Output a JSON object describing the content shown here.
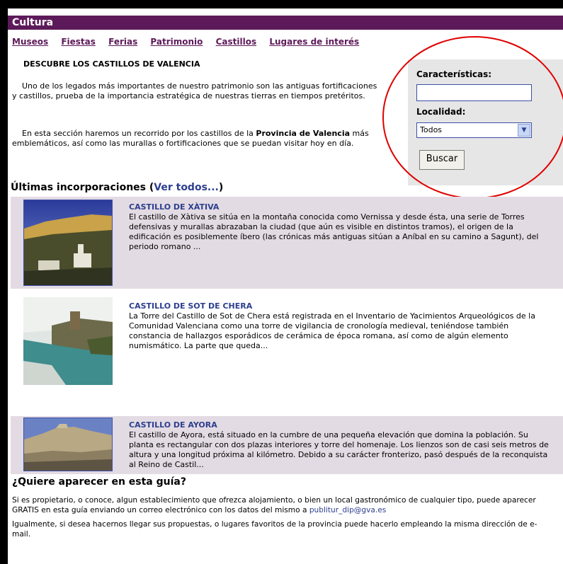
{
  "header": {
    "title": "Cultura"
  },
  "nav": [
    "Museos",
    "Fiestas",
    "Ferias",
    "Patrimonio",
    "Castillos",
    "Lugares de interés"
  ],
  "intro": {
    "title": "DESCUBRE LOS CASTILLOS DE VALENCIA",
    "p1": "Uno de los legados más importantes de nuestro patrimonio son las antiguas fortificaciones y castillos, prueba de la importancia estratégica de nuestras tierras en tiempos pretéritos.",
    "p2_pre": "En esta sección haremos un recorrido por los castillos de la ",
    "p2_bold": "Provincia de Valencia",
    "p2_post": " más emblemáticos, así como las murallas o fortificaciones que se puedan visitar hoy en día."
  },
  "search": {
    "caracteristicas_label": "Características:",
    "caracteristicas_value": "",
    "localidad_label": "Localidad:",
    "localidad_value": "Todos",
    "button": "Buscar"
  },
  "latest": {
    "title": "Últimas incorporaciones",
    "link": "Ver todos...",
    "items": [
      {
        "title": "CASTILLO DE XÀTIVA",
        "text": "El castillo de Xàtiva se sitúa en la montaña conocida como Vernissa y desde ésta, una serie de Torres defensivas y murallas abrazaban la ciudad (que aún es visible en distintos tramos), el origen de la edificación es posiblemente íbero (las crónicas más antiguas sitúan a Aníbal en su camino a Sagunt), del periodo romano ..."
      },
      {
        "title": "CASTILLO DE SOT DE CHERA",
        "text": "La Torre del Castillo de Sot de Chera está registrada en el Inventario de Yacimientos Arqueológicos de la Comunidad Valenciana como una torre de vigilancia de cronología medieval, teniéndose también constancia de hallazgos esporádicos de cerámica de época romana, así como de algún elemento numismático. La parte que queda..."
      },
      {
        "title": "CASTILLO DE AYORA",
        "text": "El castillo de Ayora, está situado en la cumbre de una pequeña elevación que domina la población. Su planta es rectangular con dos plazas interiores y torre del homenaje. Los lienzos son de casi seis metros de altura y una longitud próxima al kilómetro. Debido a su carácter fronterizo, pasó después de la reconquista al Reino de Castil..."
      }
    ]
  },
  "guide": {
    "title": "¿Quiere aparecer en esta guía?",
    "p1": "Si es propietario, o conoce, algun establecimiento que ofrezca alojamiento, o bien un local gastronómico de cualquier tipo,  puede aparecer GRATIS en esta guía enviando un correo electrónico con los datos del mismo a ",
    "email": "publitur_dip@gva.es",
    "p2": "Igualmente, si desea hacernos llegar sus propuestas, o lugares favoritos de la provincia puede hacerlo empleando la misma dirección de e-mail."
  },
  "colors": {
    "header_bg": "#5d1a5a",
    "link": "#2d3f8f",
    "row_bg": "#e3dbe3",
    "annotation": "#e00000"
  }
}
